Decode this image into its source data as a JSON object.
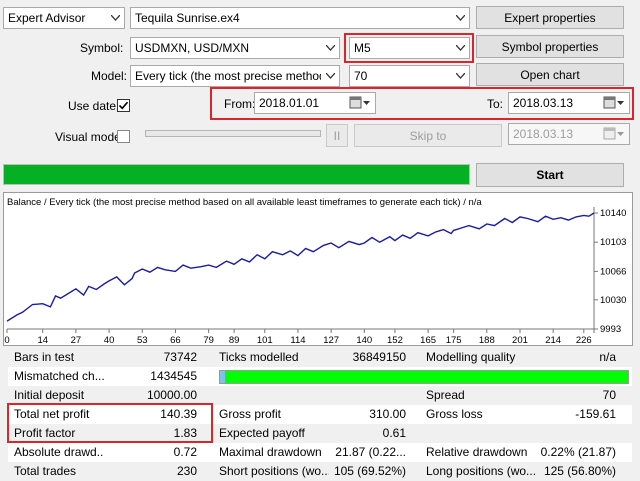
{
  "top": {
    "mode_value": "Expert Advisor",
    "expert_value": "Tequila Sunrise.ex4",
    "expert_properties_label": "Expert properties",
    "symbol_label": "Symbol:",
    "symbol_value": "USDMXN, USD/MXN",
    "period_value": "M5",
    "symbol_properties_label": "Symbol properties",
    "model_label": "Model:",
    "model_value": "Every tick (the most precise method bas",
    "spread_value": "70",
    "open_chart_label": "Open chart",
    "use_date_label": "Use date",
    "use_date_checked": true,
    "from_label": "From:",
    "from_value": "2018.01.01",
    "to_label": "To:",
    "to_value": "2018.03.13",
    "visual_mode_label": "Visual mode",
    "visual_mode_checked": false,
    "pause_label": "II",
    "skip_to_label": "Skip to",
    "skip_date_value": "2018.03.13",
    "progress": 1.0,
    "start_label": "Start"
  },
  "chart_data": {
    "type": "line",
    "title": "Balance / Every tick (the most precise method based on all available least timeframes to generate each tick) / n/a",
    "x_ticks": [
      "0",
      "14",
      "27",
      "40",
      "53",
      "66",
      "79",
      "89",
      "101",
      "114",
      "127",
      "140",
      "152",
      "165",
      "175",
      "188",
      "201",
      "214",
      "226"
    ],
    "y_ticks": [
      "10140",
      "10103",
      "10066",
      "10030",
      "9993"
    ],
    "ylim": [
      9993,
      10140
    ],
    "xlim": [
      0,
      230
    ],
    "series": [
      {
        "color": "#1c1ca0",
        "x": [
          0,
          4,
          6,
          8,
          10,
          14,
          17,
          19,
          21,
          24,
          27,
          30,
          32,
          35,
          38,
          40,
          43,
          46,
          49,
          50,
          53,
          56,
          59,
          62,
          66,
          69,
          72,
          76,
          79,
          82,
          86,
          89,
          92,
          95,
          98,
          101,
          104,
          108,
          111,
          114,
          117,
          120,
          124,
          127,
          130,
          134,
          138,
          140,
          143,
          146,
          150,
          152,
          155,
          158,
          161,
          165,
          168,
          171,
          174,
          175,
          178,
          181,
          185,
          188,
          191,
          195,
          198,
          201,
          204,
          208,
          211,
          214,
          217,
          220,
          223,
          226,
          228,
          230
        ],
        "y": [
          10003,
          10011,
          10014,
          10019,
          10024,
          10025,
          10021,
          10035,
          10032,
          10038,
          10044,
          10036,
          10047,
          10043,
          10050,
          10054,
          10059,
          10049,
          10057,
          10064,
          10069,
          10065,
          10071,
          10068,
          10066,
          10074,
          10070,
          10072,
          10074,
          10071,
          10079,
          10075,
          10082,
          10078,
          10087,
          10082,
          10091,
          10087,
          10092,
          10086,
          10095,
          10091,
          10099,
          10102,
          10096,
          10104,
          10100,
          10102,
          10109,
          10103,
          10110,
          10105,
          10112,
          10108,
          10115,
          10111,
          10116,
          10119,
          10114,
          10118,
          10121,
          10124,
          10120,
          10126,
          10124,
          10133,
          10128,
          10135,
          10133,
          10129,
          10136,
          10132,
          10134,
          10131,
          10135,
          10137,
          10136,
          10140
        ]
      }
    ]
  },
  "results": {
    "rows": [
      {
        "c1": "Bars in test",
        "v1": "73742",
        "c2": "Ticks modelled",
        "v2": "36849150",
        "c3": "Modelling quality",
        "v3": "n/a"
      },
      {
        "c1": "Mismatched ch...",
        "v1": "1434545",
        "c2": "",
        "v2": "",
        "c3": "",
        "v3": ""
      },
      {
        "c1": "Initial deposit",
        "v1": "10000.00",
        "c2": "",
        "v2": "",
        "c3": "Spread",
        "v3": "70"
      },
      {
        "c1": "Total net profit",
        "v1": "140.39",
        "c2": "Gross profit",
        "v2": "310.00",
        "c3": "Gross loss",
        "v3": "-159.61"
      },
      {
        "c1": "Profit factor",
        "v1": "1.83",
        "c2": "Expected payoff",
        "v2": "0.61",
        "c3": "",
        "v3": ""
      },
      {
        "c1": "Absolute drawd...",
        "v1": "0.72",
        "c2": "Maximal drawdown",
        "v2": "21.87 (0.22...",
        "c3": "Relative drawdown",
        "v3": "0.22% (21.87)"
      },
      {
        "c1": "Total trades",
        "v1": "230",
        "c2": "Short positions (wo...",
        "v2": "105 (69.52%)",
        "c3": "Long positions (wo...",
        "v3": "125 (56.80%)"
      }
    ]
  },
  "colors": {
    "progress": "#06b025",
    "quality_bar": "#00ff00",
    "highlight": "#d9262d",
    "line": "#1c1ca0"
  }
}
